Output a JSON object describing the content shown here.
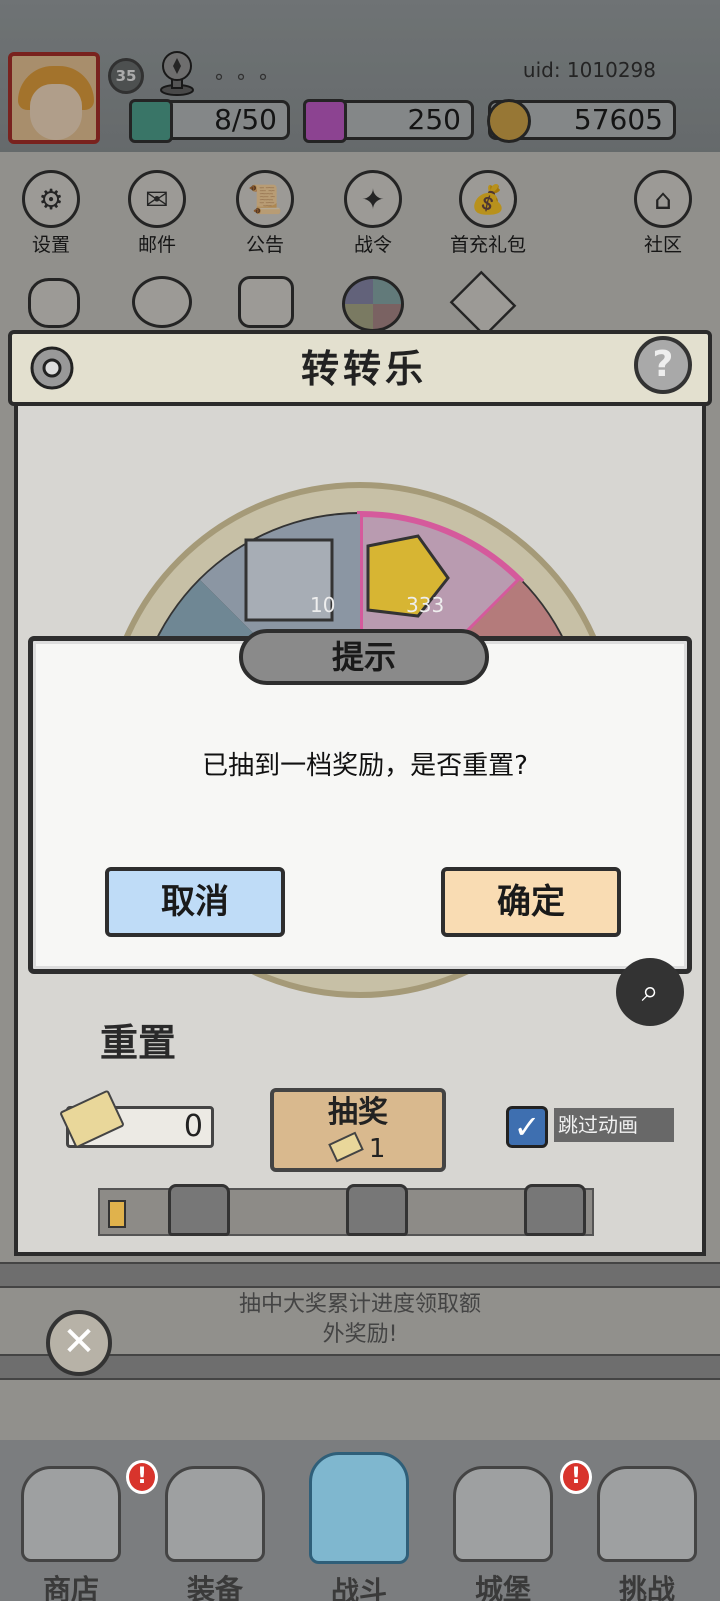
{
  "player": {
    "level": "35",
    "uid": "uid: 1010298",
    "stamina": "8/50",
    "gems": "250",
    "coins": "57605"
  },
  "menu_row1": [
    {
      "label": "设置",
      "icon": "gear-icon"
    },
    {
      "label": "邮件",
      "icon": "mail-icon"
    },
    {
      "label": "公告",
      "icon": "scroll-icon"
    },
    {
      "label": "战令",
      "icon": "orb-icon"
    },
    {
      "label": "首充礼包",
      "icon": "gift-bag-icon"
    },
    {
      "label": "社区",
      "icon": "home-icon"
    }
  ],
  "panel": {
    "title": "转转乐",
    "help": "?"
  },
  "wheel": {
    "slots": [
      {
        "item": "silver-ingot",
        "count": "10"
      },
      {
        "item": "gold-hexagon",
        "count": "333"
      }
    ]
  },
  "controls": {
    "reset_label": "重置",
    "ticket_count": "0",
    "draw_label": "抽奖",
    "draw_cost": "1",
    "skip_label": "跳过动画",
    "progress": 0.04
  },
  "hint": {
    "line1": "抽中大奖累计进度领取额",
    "line2": "外奖励!"
  },
  "dialog": {
    "title": "提示",
    "message": "已抽到一档奖励，是否重置?",
    "cancel": "取消",
    "confirm": "确定"
  },
  "nav": [
    {
      "label": "商店",
      "badge": "!"
    },
    {
      "label": "装备",
      "badge": ""
    },
    {
      "label": "战斗",
      "badge": ""
    },
    {
      "label": "城堡",
      "badge": "!"
    },
    {
      "label": "挑战",
      "badge": ""
    }
  ],
  "colors": {
    "cancel_button": "#bfdcf7",
    "confirm_button": "#f9dcb3",
    "draw_button": "#d9b98e",
    "alert_badge": "#d8342c"
  }
}
